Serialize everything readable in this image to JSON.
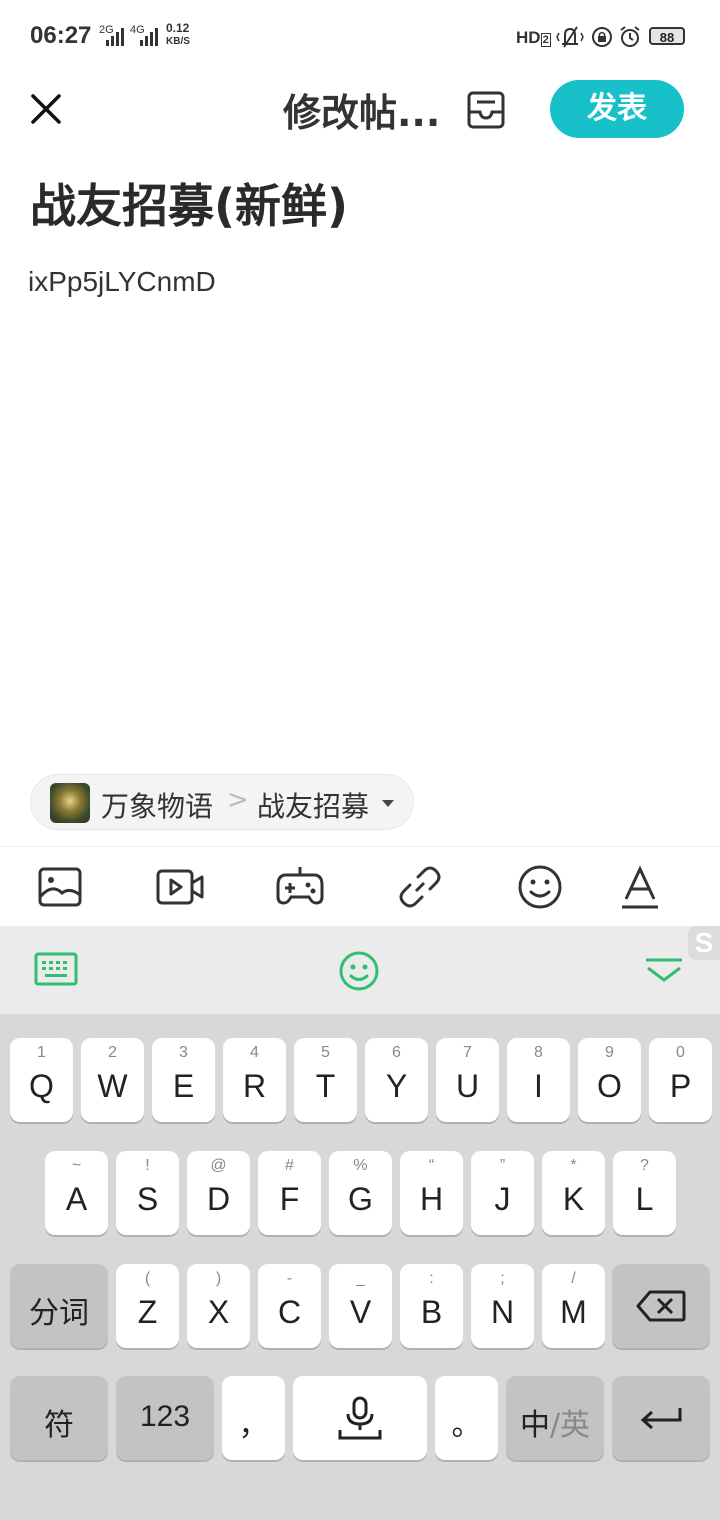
{
  "status_bar": {
    "time": "06:27",
    "net_2g": "2G",
    "net_4g": "4G",
    "speed_value": "0.12",
    "speed_unit": "KB/S",
    "hd_label": "HD",
    "battery": "88"
  },
  "header": {
    "title": "修改帖...",
    "publish_label": "发表"
  },
  "post": {
    "title": "战友招募(新鲜)",
    "body": "ixPp5jLYCnmD"
  },
  "category": {
    "game": "万象物语",
    "separator": ">",
    "section": "战友招募"
  },
  "toolbar": {
    "icons": [
      "image-icon",
      "video-icon",
      "game-controller-icon",
      "link-icon",
      "emoji-icon",
      "text-format-icon"
    ]
  },
  "ime": {
    "accent": "#2fbf71"
  },
  "keyboard": {
    "row1": [
      {
        "hint": "1",
        "label": "Q"
      },
      {
        "hint": "2",
        "label": "W"
      },
      {
        "hint": "3",
        "label": "E"
      },
      {
        "hint": "4",
        "label": "R"
      },
      {
        "hint": "5",
        "label": "T"
      },
      {
        "hint": "6",
        "label": "Y"
      },
      {
        "hint": "7",
        "label": "U"
      },
      {
        "hint": "8",
        "label": "I"
      },
      {
        "hint": "9",
        "label": "O"
      },
      {
        "hint": "0",
        "label": "P"
      }
    ],
    "row2": [
      {
        "hint": "~",
        "label": "A"
      },
      {
        "hint": "!",
        "label": "S"
      },
      {
        "hint": "@",
        "label": "D"
      },
      {
        "hint": "#",
        "label": "F"
      },
      {
        "hint": "%",
        "label": "G"
      },
      {
        "hint": "“",
        "label": "H"
      },
      {
        "hint": "”",
        "label": "J"
      },
      {
        "hint": "*",
        "label": "K"
      },
      {
        "hint": "?",
        "label": "L"
      }
    ],
    "row3": [
      {
        "hint": "(",
        "label": "Z"
      },
      {
        "hint": ")",
        "label": "X"
      },
      {
        "hint": "-",
        "label": "C"
      },
      {
        "hint": "_",
        "label": "V"
      },
      {
        "hint": ":",
        "label": "B"
      },
      {
        "hint": ";",
        "label": "N"
      },
      {
        "hint": "/",
        "label": "M"
      }
    ],
    "segment_label": "分词",
    "symbols_label": "符",
    "numbers_label": "123",
    "comma_label": "，",
    "period_label": "。",
    "lang_label_zh": "中",
    "lang_label_en": "/英"
  }
}
